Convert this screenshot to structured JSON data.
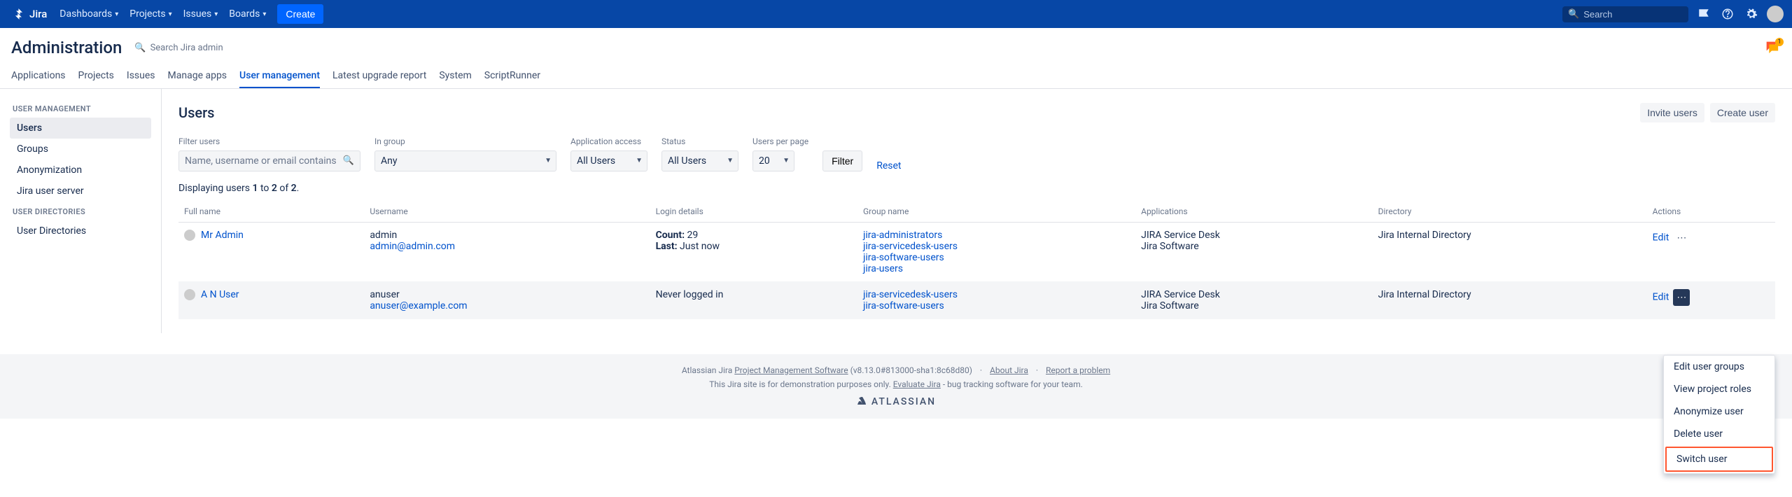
{
  "topnav": {
    "brand": "Jira",
    "items": [
      "Dashboards",
      "Projects",
      "Issues",
      "Boards"
    ],
    "create": "Create",
    "search_placeholder": "Search"
  },
  "header": {
    "title": "Administration",
    "search_placeholder": "Search Jira admin",
    "feedback_badge": "1"
  },
  "tabs": [
    "Applications",
    "Projects",
    "Issues",
    "Manage apps",
    "User management",
    "Latest upgrade report",
    "System",
    "ScriptRunner"
  ],
  "active_tab": "User management",
  "sidebar": {
    "groups": [
      {
        "header": "USER MANAGEMENT",
        "items": [
          "Users",
          "Groups",
          "Anonymization"
        ],
        "active": "Users"
      },
      {
        "header": "",
        "items": [
          "Jira user server"
        ]
      },
      {
        "header": "USER DIRECTORIES",
        "items": [
          "User Directories"
        ]
      }
    ]
  },
  "main": {
    "title": "Users",
    "actions": {
      "invite": "Invite users",
      "create": "Create user"
    },
    "filters": {
      "filter_users_label": "Filter users",
      "filter_users_placeholder": "Name, username or email contains",
      "in_group_label": "In group",
      "in_group_value": "Any",
      "app_access_label": "Application access",
      "app_access_value": "All Users",
      "status_label": "Status",
      "status_value": "All Users",
      "per_page_label": "Users per page",
      "per_page_value": "20",
      "filter_btn": "Filter",
      "reset": "Reset"
    },
    "display_prefix": "Displaying users ",
    "display_a": "1",
    "display_to": " to ",
    "display_b": "2",
    "display_of": " of ",
    "display_c": "2",
    "columns": [
      "Full name",
      "Username",
      "Login details",
      "Group name",
      "Applications",
      "Directory",
      "Actions"
    ],
    "rows": [
      {
        "name": "Mr Admin",
        "username": "admin",
        "email": "admin@admin.com",
        "login_count_label": "Count:",
        "login_count": "29",
        "login_last_label": "Last:",
        "login_last": "Just now",
        "groups": [
          "jira-administrators",
          "jira-servicedesk-users",
          "jira-software-users",
          "jira-users"
        ],
        "apps": [
          "JIRA Service Desk",
          "Jira Software"
        ],
        "directory": "Jira Internal Directory",
        "edit": "Edit"
      },
      {
        "name": "A N User",
        "username": "anuser",
        "email": "anuser@example.com",
        "login_never": "Never logged in",
        "groups": [
          "jira-servicedesk-users",
          "jira-software-users"
        ],
        "apps": [
          "JIRA Service Desk",
          "Jira Software"
        ],
        "directory": "Jira Internal Directory",
        "edit": "Edit"
      }
    ],
    "dropdown": [
      "Edit user groups",
      "View project roles",
      "Anonymize user",
      "Delete user",
      "Switch user"
    ],
    "dropdown_highlight": "Switch user"
  },
  "footer": {
    "line1a": "Atlassian Jira ",
    "line1_link": "Project Management Software",
    "line1b": " (v8.13.0#813000-sha1:8c68d80)",
    "about": "About Jira",
    "report": "Report a problem",
    "line2a": "This Jira site is for demonstration purposes only. ",
    "line2_link": "Evaluate Jira",
    "line2b": " - bug tracking software for your team.",
    "brand": "ATLASSIAN"
  }
}
